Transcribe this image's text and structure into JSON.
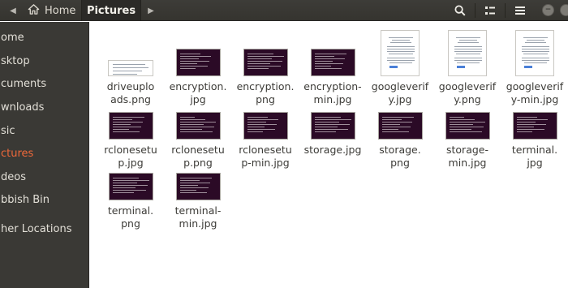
{
  "header": {
    "back_icon": "chevron-left-icon",
    "home_label": "Home",
    "current_label": "Pictures",
    "forward_icon": "chevron-right-icon",
    "search_icon": "search-icon",
    "view_icon": "list-view-icon",
    "menu_icon": "hamburger-menu-icon",
    "minimize_icon": "minimize-icon",
    "maximize_icon": "maximize-icon",
    "close_icon": "close-icon"
  },
  "sidebar": {
    "items": [
      {
        "label": "ome"
      },
      {
        "label": "sktop"
      },
      {
        "label": "cuments"
      },
      {
        "label": "wnloads"
      },
      {
        "label": "sic"
      },
      {
        "label": "ctures"
      },
      {
        "label": "deos"
      },
      {
        "label": "bbish Bin"
      },
      {
        "label": "her Locations"
      }
    ],
    "active_color": "#f0693a"
  },
  "files": [
    {
      "name": "driveuploads.png",
      "type": "doc-wide"
    },
    {
      "name": "encryption.jpg",
      "type": "terminal"
    },
    {
      "name": "encryption.png",
      "type": "terminal"
    },
    {
      "name": "encryption-min.jpg",
      "type": "terminal"
    },
    {
      "name": "googleverify.jpg",
      "type": "doc-tall"
    },
    {
      "name": "googleverify.png",
      "type": "doc-tall"
    },
    {
      "name": "googleverify-min.jpg",
      "type": "doc-tall"
    },
    {
      "name": "rclonesetup.jpg",
      "type": "terminal"
    },
    {
      "name": "rclonesetup.png",
      "type": "terminal"
    },
    {
      "name": "rclonesetup-min.jpg",
      "type": "terminal"
    },
    {
      "name": "storage.jpg",
      "type": "terminal"
    },
    {
      "name": "storage.png",
      "type": "terminal"
    },
    {
      "name": "storage-min.jpg",
      "type": "terminal"
    },
    {
      "name": "terminal.jpg",
      "type": "terminal"
    },
    {
      "name": "terminal.png",
      "type": "terminal"
    },
    {
      "name": "terminal-min.jpg",
      "type": "terminal"
    }
  ],
  "file_label_lines": [
    [
      "driveuplo",
      "ads.png"
    ],
    [
      "encryption.",
      "jpg"
    ],
    [
      "encryption.",
      "png"
    ],
    [
      "encryption-",
      "min.jpg"
    ],
    [
      "googleverif",
      "y.jpg"
    ],
    [
      "googleverif",
      "y.png"
    ],
    [
      "googleverif",
      "y-min.jpg"
    ],
    [
      "rclonesetu",
      "p.jpg"
    ],
    [
      "rclonesetu",
      "p.png"
    ],
    [
      "rclonesetu",
      "p-min.jpg"
    ],
    [
      "storage.jpg"
    ],
    [
      "storage.",
      "png"
    ],
    [
      "storage-",
      "min.jpg"
    ],
    [
      "terminal.",
      "jpg"
    ],
    [
      "terminal.",
      "png"
    ],
    [
      "terminal-",
      "min.jpg"
    ]
  ]
}
